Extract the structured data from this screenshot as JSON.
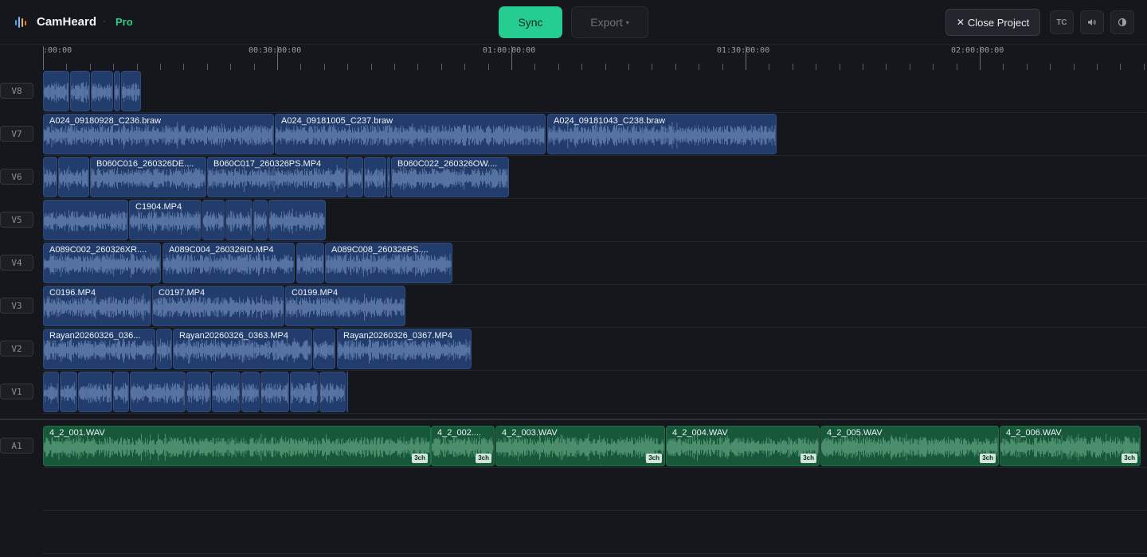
{
  "header": {
    "app_name": "CamHeard",
    "separator": "·",
    "badge": "Pro",
    "sync_label": "Sync",
    "export_label": "Export",
    "export_caret": "▾",
    "close_label": "Close Project",
    "close_glyph": "✕",
    "tc_label": "TC",
    "volume_icon": "speaker-icon",
    "theme_icon": "contrast-icon"
  },
  "colors": {
    "accent": "#26cd91",
    "video_clip": "#223d6b",
    "audio_clip": "#17583a"
  },
  "ruler": {
    "labels": [
      ":00:00",
      "00:30:00:00",
      "01:00:00:00",
      "01:30:00:00",
      "02:00:00:00"
    ]
  },
  "tracks": [
    {
      "id": "V8",
      "clips": [
        {
          "name": ""
        },
        {
          "name": ""
        },
        {
          "name": ""
        },
        {
          "name": ""
        },
        {
          "name": ""
        }
      ]
    },
    {
      "id": "V7",
      "clips": [
        {
          "name": "A024_09180928_C236.braw"
        },
        {
          "name": "A024_09181005_C237.braw"
        },
        {
          "name": "A024_09181043_C238.braw"
        }
      ]
    },
    {
      "id": "V6",
      "clips": [
        {
          "name": ""
        },
        {
          "name": ""
        },
        {
          "name": "B060C016_260326DE...."
        },
        {
          "name": "B060C017_260326PS.MP4"
        },
        {
          "name": ""
        },
        {
          "name": ""
        },
        {
          "name": ""
        },
        {
          "name": "B060C022_260326OW...."
        }
      ]
    },
    {
      "id": "V5",
      "clips": [
        {
          "name": ""
        },
        {
          "name": "C1904.MP4"
        },
        {
          "name": ""
        },
        {
          "name": ""
        },
        {
          "name": ""
        },
        {
          "name": ""
        }
      ]
    },
    {
      "id": "V4",
      "clips": [
        {
          "name": "A089C002_260326XR...."
        },
        {
          "name": "A089C004_260326ID.MP4"
        },
        {
          "name": ""
        },
        {
          "name": "A089C008_260326PS...."
        }
      ]
    },
    {
      "id": "V3",
      "clips": [
        {
          "name": "C0196.MP4"
        },
        {
          "name": "C0197.MP4"
        },
        {
          "name": "C0199.MP4"
        }
      ]
    },
    {
      "id": "V2",
      "clips": [
        {
          "name": "Rayan20260326_036..."
        },
        {
          "name": ""
        },
        {
          "name": "Rayan20260326_0363.MP4"
        },
        {
          "name": ""
        },
        {
          "name": "Rayan20260326_0367.MP4"
        }
      ]
    },
    {
      "id": "V1",
      "clips": [
        {
          "name": ""
        },
        {
          "name": ""
        },
        {
          "name": ""
        },
        {
          "name": ""
        },
        {
          "name": ""
        },
        {
          "name": ""
        },
        {
          "name": ""
        },
        {
          "name": ""
        },
        {
          "name": ""
        },
        {
          "name": ""
        },
        {
          "name": ""
        },
        {
          "name": ""
        }
      ]
    },
    {
      "id": "A1",
      "clips": [
        {
          "name": "4_2_001.WAV",
          "channels": "3ch"
        },
        {
          "name": "4_2_002....",
          "channels": "3ch"
        },
        {
          "name": "4_2_003.WAV",
          "channels": "3ch"
        },
        {
          "name": "4_2_004.WAV",
          "channels": "3ch"
        },
        {
          "name": "4_2_005.WAV",
          "channels": "3ch"
        },
        {
          "name": "4_2_006.WAV",
          "channels": "3ch"
        }
      ]
    }
  ]
}
